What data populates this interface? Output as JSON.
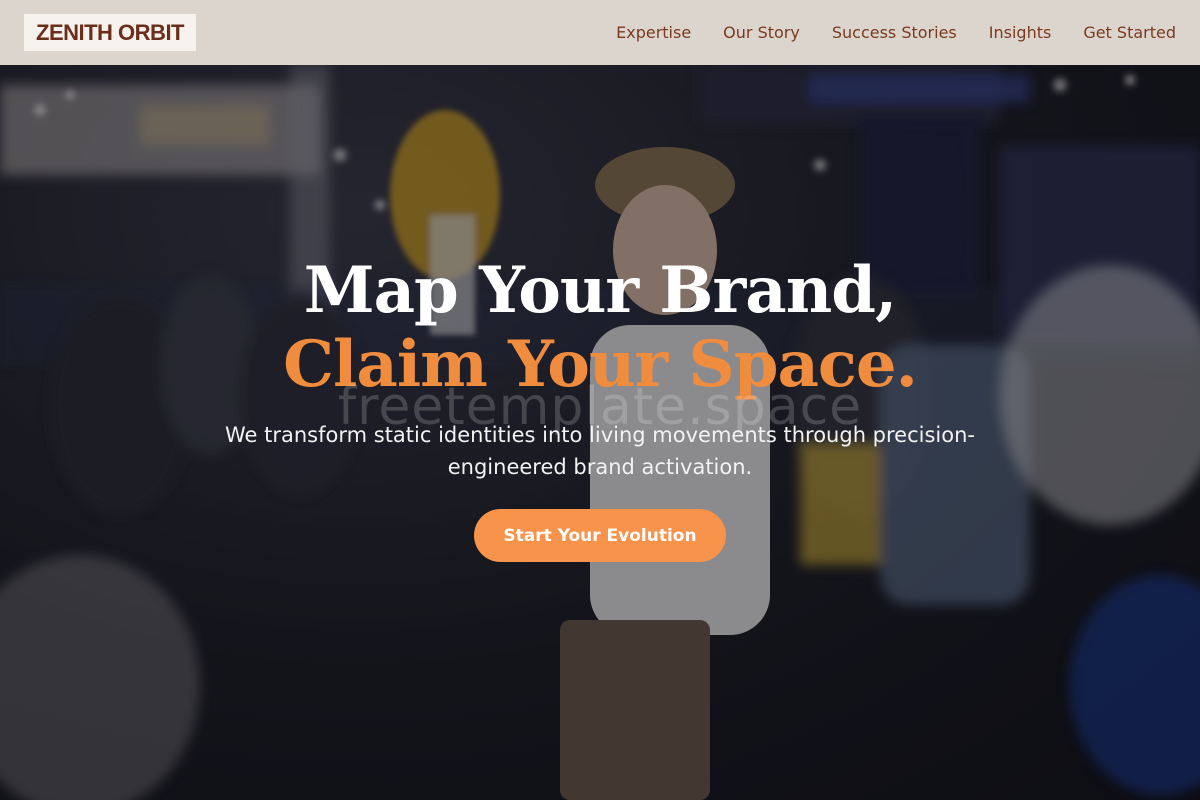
{
  "brand": {
    "logo_text": "ZENITH ORBIT",
    "colors": {
      "header_bg": "#dcd5ce",
      "logo_text": "#6b2e1a",
      "nav_text": "#7a3a1f",
      "accent": "#f08c3e",
      "button_bg": "#f7934a"
    }
  },
  "nav": {
    "items": [
      {
        "label": "Expertise"
      },
      {
        "label": "Our Story"
      },
      {
        "label": "Success Stories"
      },
      {
        "label": "Insights"
      },
      {
        "label": "Get Started"
      }
    ]
  },
  "hero": {
    "headline_line1": "Map Your Brand,",
    "headline_line2": "Claim Your Space.",
    "watermark": "freetemplate.space",
    "subtext": "We transform static identities into living movements through precision-engineered brand activation.",
    "cta_label": "Start Your Evolution",
    "background": "event-expo-photo"
  }
}
